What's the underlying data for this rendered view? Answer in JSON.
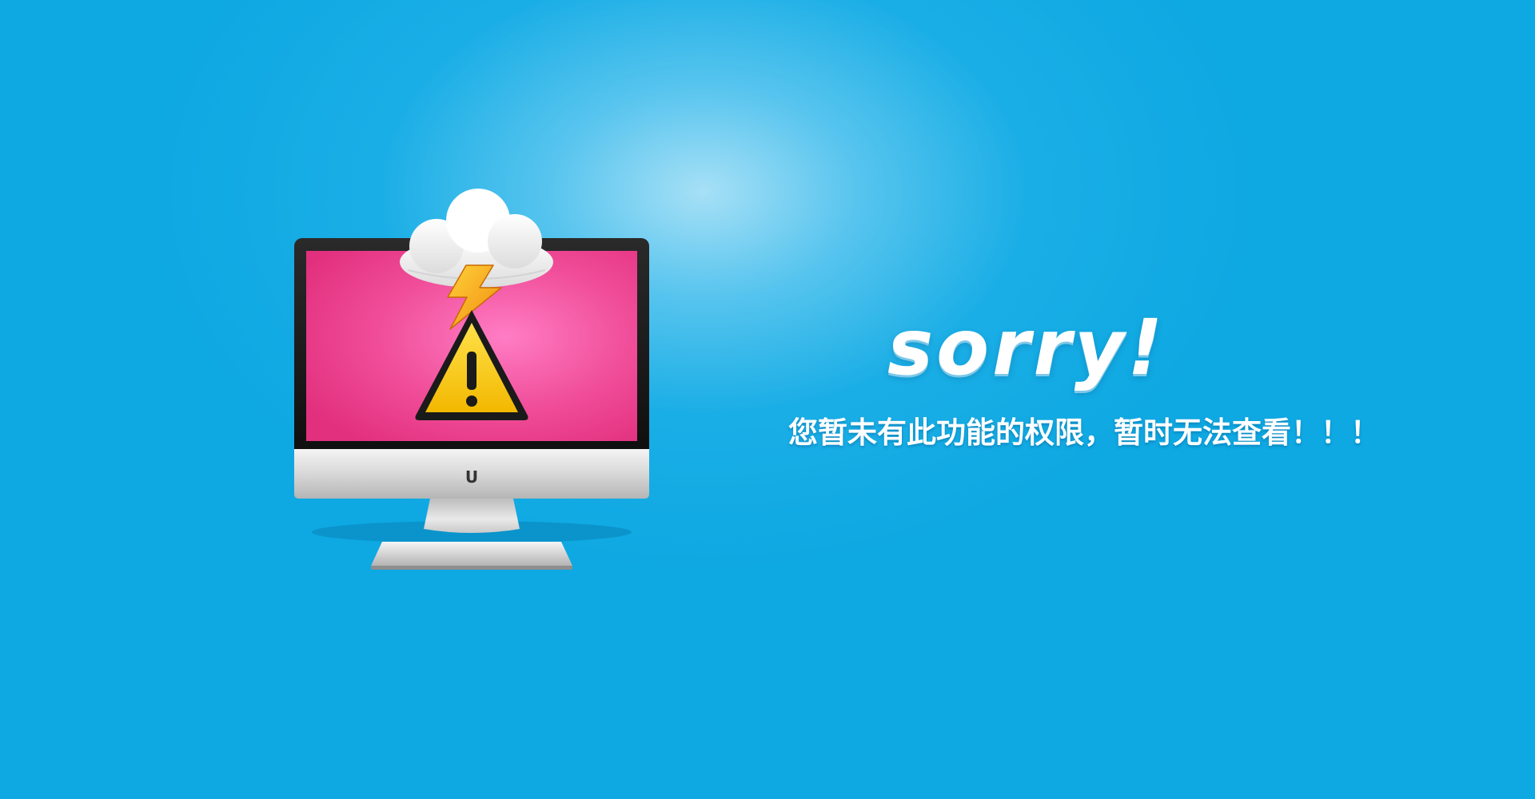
{
  "message": {
    "title": "sorry!",
    "text": "您暂未有此功能的权限，暂时无法查看！！！"
  },
  "illustration": {
    "icons": [
      "computer-monitor-icon",
      "cloud-icon",
      "lightning-bolt-icon",
      "warning-triangle-icon"
    ],
    "monitor_logo": "U"
  },
  "colors": {
    "background": "#0ea8e2",
    "background_highlight": "#a6e0f6",
    "screen": "#ee3f8c",
    "warning_fill": "#f5c300",
    "bolt": "#f4a417",
    "text": "#ffffff"
  }
}
